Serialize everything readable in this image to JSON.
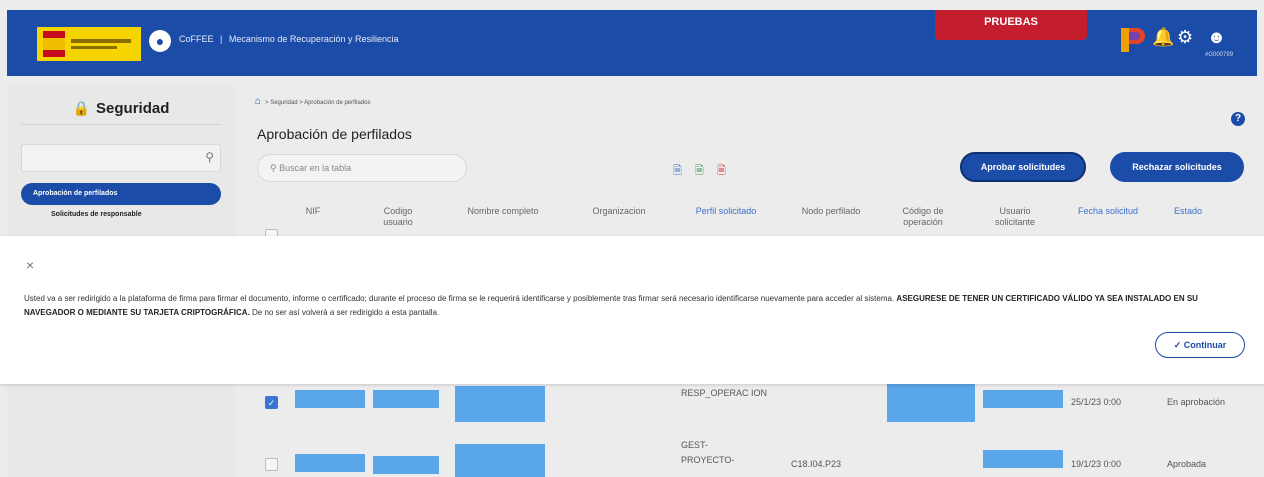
{
  "header": {
    "app_name": "CoFFEE",
    "separator": "|",
    "app_subtitle": "Mecanismo de Recuperación y Resiliencia",
    "env_badge": "PRUEBAS",
    "user_code": "#G000799",
    "colors": {
      "bar": "#1b4ca8",
      "badge": "#c41e2e"
    }
  },
  "sidebar": {
    "title": "Seguridad",
    "search_placeholder": "",
    "items": [
      {
        "label": "Aprobación de perfilados",
        "active": true
      },
      {
        "label": "Solicitudes de responsable",
        "active": false
      }
    ]
  },
  "main": {
    "breadcrumb": "> Seguridad > Aprobación de perfilados",
    "title": "Aprobación de perfilados",
    "search_placeholder": "Buscar en la tabla",
    "approve_label": "Aprobar solicitudes",
    "reject_label": "Rechazar solicitudes",
    "columns": [
      "NIF",
      "Codigo usuario",
      "Nombre completo",
      "Organizacion",
      "Perfil solicitado",
      "Nodo perfilado",
      "Código de operación",
      "Usuario solicitante",
      "Fecha solicitud",
      "Estado"
    ],
    "rows": [
      {
        "checked": true,
        "perfil": "RESP_OPERAC ION",
        "nodo": "",
        "fecha": "25/1/23 0:00",
        "estado": "En aprobación"
      },
      {
        "checked": false,
        "perfil": "GEST- PROYECTO-",
        "nodo": "C18.I04.P23",
        "fecha": "19/1/23 0:00",
        "estado": "Aprobada"
      }
    ]
  },
  "modal": {
    "close_label": "×",
    "message_part1": "Usted va a ser redirigido a la plataforma de firma para firmar el documento, informe o certificado; durante el proceso de firma se le requerirá identificarse y posiblemente tras firmar será necesario identificarse nuevamente para acceder al sistema. ",
    "message_bold": "ASEGURESE DE TENER UN CERTIFICADO VÁLIDO YA SEA INSTALADO EN SU NAVEGADOR O MEDIANTE SU TARJETA CRIPTOGRÁFICA.",
    "message_part2": " De no ser así volverá a ser redirigido a esta pantalla.",
    "continue_label": "Continuar"
  }
}
